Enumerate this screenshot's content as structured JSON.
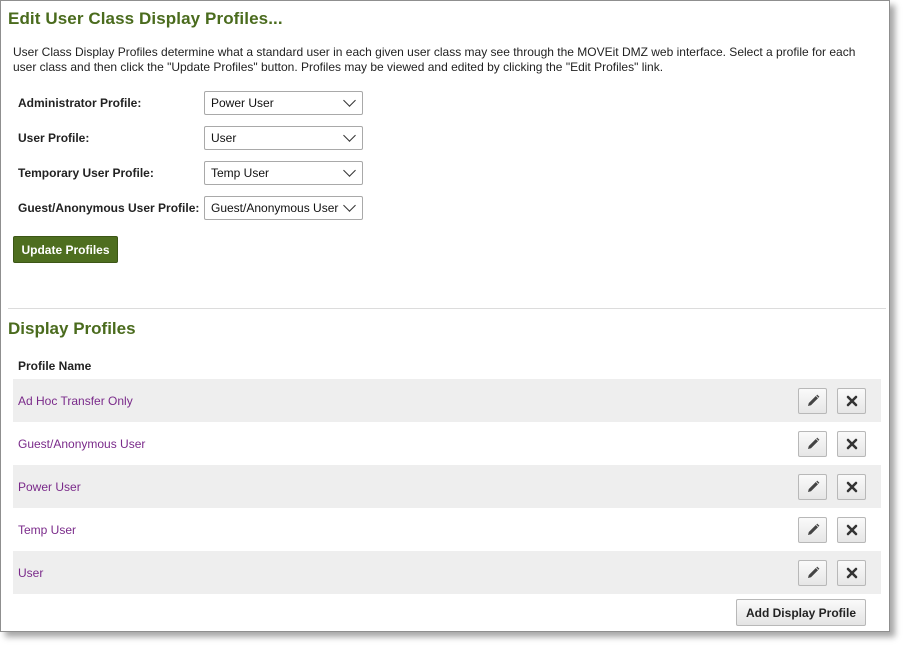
{
  "page": {
    "title": "Edit User Class Display Profiles...",
    "description": "User Class Display Profiles determine what a standard user in each given user class may see through the MOVEit DMZ web interface. Select a profile for each user class and then click the \"Update Profiles\" button. Profiles may be viewed and edited by clicking the \"Edit Profiles\" link."
  },
  "form": {
    "rows": [
      {
        "label": "Administrator Profile:",
        "value": "Power User"
      },
      {
        "label": "User Profile:",
        "value": "User"
      },
      {
        "label": "Temporary User Profile:",
        "value": "Temp User"
      },
      {
        "label": "Guest/Anonymous User Profile:",
        "value": "Guest/Anonymous User"
      }
    ],
    "update_label": "Update Profiles"
  },
  "profiles": {
    "title": "Display Profiles",
    "column_header": "Profile Name",
    "rows": [
      {
        "name": "Ad Hoc Transfer Only"
      },
      {
        "name": "Guest/Anonymous User"
      },
      {
        "name": "Power User"
      },
      {
        "name": "Temp User"
      },
      {
        "name": "User"
      }
    ],
    "row_icons": {
      "edit": "pencil-icon",
      "delete": "x-icon"
    },
    "add_label": "Add Display Profile"
  },
  "colors": {
    "heading": "#4a6b1d",
    "primary_button": "#4e6e1f",
    "link": "#7a2a8a",
    "row_shade": "#eeeeee"
  }
}
